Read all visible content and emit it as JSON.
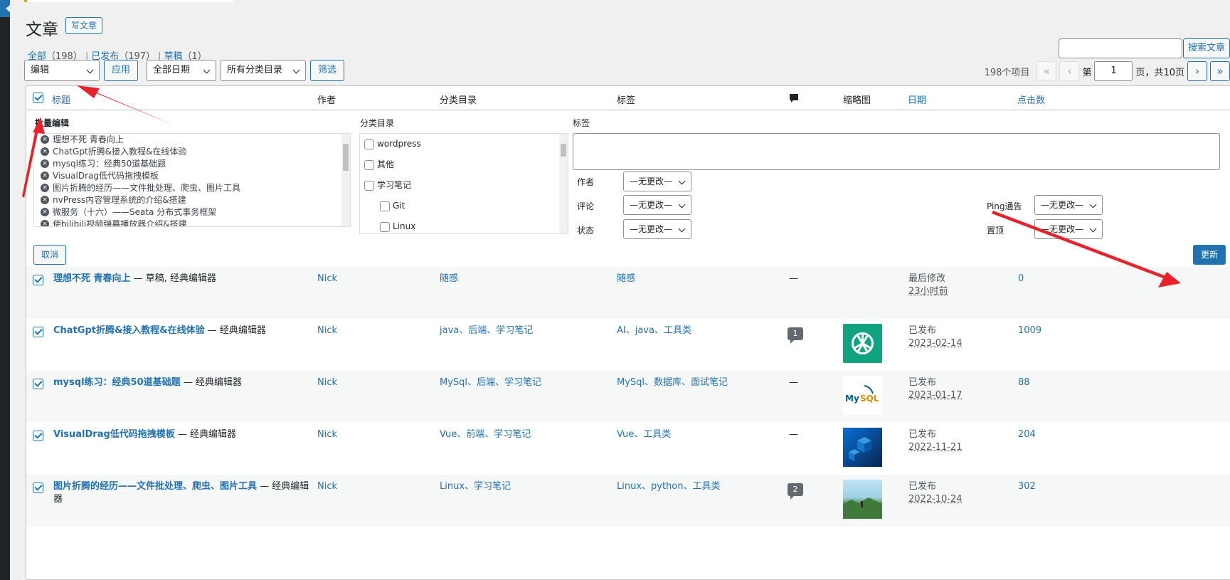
{
  "page": {
    "title": "文章",
    "add_new": "写文章",
    "views": [
      {
        "label": "全部",
        "count": "（198）"
      },
      {
        "label": "已发布",
        "count": "（197）"
      },
      {
        "label": "草稿",
        "count": "（1）"
      }
    ],
    "search_button": "搜索文章"
  },
  "filters": {
    "bulk_action": "编辑",
    "apply": "应用",
    "date": "全部日期",
    "category": "所有分类目录",
    "filter_button": "筛选"
  },
  "pagination": {
    "items": "198个项目",
    "first": "«",
    "prev": "‹",
    "page_prefix": "第",
    "current": "1",
    "page_suffix": "页，共10页",
    "next": "›",
    "last": "»"
  },
  "columns": {
    "title": "标题",
    "author": "作者",
    "categories": "分类目录",
    "tags": "标签",
    "thumbnail": "缩略图",
    "date": "日期",
    "clicks": "点击数"
  },
  "bulk_edit": {
    "heading": "批量编辑",
    "titles": [
      "理想不死 青春向上",
      "ChatGpt折腾&接入教程&在线体验",
      "mysql练习：经典50道基础题",
      "VisualDrag低代码拖拽模板",
      "图片折腾的经历——文件批处理、爬虫、图片工具",
      "nvPress内容管理系统的介绍&搭建",
      "微服务（十六）——Seata 分布式事务框架",
      "使bilibili视频弹幕播放器介绍&搭建"
    ],
    "categories_label": "分类目录",
    "categories": [
      {
        "label": "wordpress",
        "sub": false
      },
      {
        "label": "其他",
        "sub": false
      },
      {
        "label": "学习笔记",
        "sub": false
      },
      {
        "label": "Git",
        "sub": true
      },
      {
        "label": "Linux",
        "sub": true
      }
    ],
    "tags_label": "标签",
    "author_label": "作者",
    "comment_label": "评论",
    "status_label": "状态",
    "ping_label": "Ping通告",
    "sticky_label": "置顶",
    "no_change": "—无更改—",
    "cancel": "取消",
    "update": "更新"
  },
  "rows": [
    {
      "title": "理想不死 青春向上",
      "suffix": " — 草稿, 经典编辑器",
      "author": "Nick",
      "categories": "随感",
      "tags": "随感",
      "comments": "—",
      "status": "最后修改",
      "date": "23小时前",
      "clicks": "0",
      "thumb": "none"
    },
    {
      "title": "ChatGpt折腾&接入教程&在线体验",
      "suffix": " — 经典编辑器",
      "author": "Nick",
      "categories": "java、后端、学习笔记",
      "tags": "AI、java、工具类",
      "comments": "1",
      "status": "已发布",
      "date": "2023-02-14",
      "clicks": "1009",
      "thumb": "chatgpt"
    },
    {
      "title": "mysql练习：经典50道基础题",
      "suffix": " — 经典编辑器",
      "author": "Nick",
      "categories": "MySql、后端、学习笔记",
      "tags": "MySql、数据库、面试笔记",
      "comments": "—",
      "status": "已发布",
      "date": "2023-01-17",
      "clicks": "88",
      "thumb": "mysql"
    },
    {
      "title": "VisualDrag低代码拖拽模板",
      "suffix": " — 经典编辑器",
      "author": "Nick",
      "categories": "Vue、前端、学习笔记",
      "tags": "Vue、工具类",
      "comments": "—",
      "status": "已发布",
      "date": "2022-11-21",
      "clicks": "204",
      "thumb": "cubes"
    },
    {
      "title": "图片折腾的经历——文件批处理、爬虫、图片工具",
      "suffix": " — 经典编辑器",
      "author": "Nick",
      "categories": "Linux、学习笔记",
      "tags": "Linux、python、工具类",
      "comments": "2",
      "status": "已发布",
      "date": "2022-10-24",
      "clicks": "302",
      "thumb": "landscape"
    }
  ],
  "colors": {
    "accent": "#2271b1",
    "arrow": "#e8222a",
    "mysql_blue": "#00618a",
    "mysql_orange": "#e48e00",
    "chatgpt": "#10a37f"
  }
}
